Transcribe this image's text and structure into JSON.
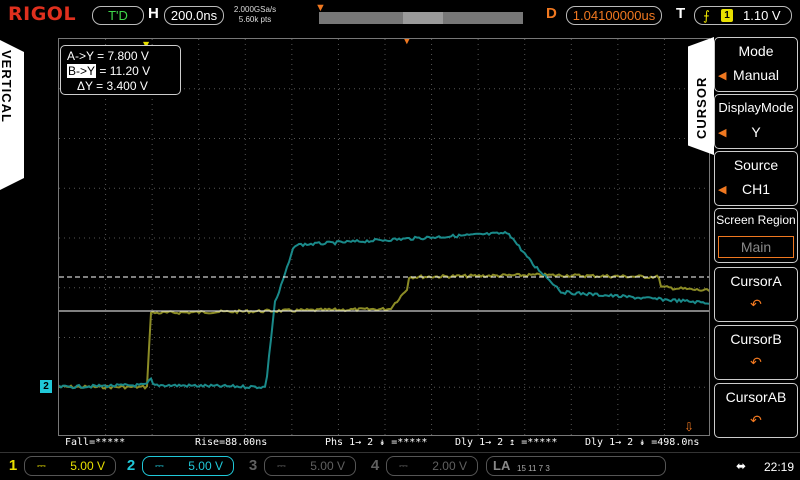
{
  "brand": {
    "logo": "RIGOL"
  },
  "topbar": {
    "trigger_status": "T'D",
    "h_label": "H",
    "timebase": "200.0ns",
    "sample_rate": "2.000GSa/s",
    "mem_depth": "5.60k pts",
    "d_label": "D",
    "delay": "1.04100000us",
    "t_label": "T",
    "trig_source": "1",
    "trig_level": "1.10 V"
  },
  "left_tab": {
    "label": "VERTICAL"
  },
  "cursor_readout": {
    "a_line": "A->Y = 7.800 V",
    "b_prefix": "B->Y",
    "b_value": " = 11.20 V",
    "delta_line": "ΔY = 3.400 V"
  },
  "measurements": {
    "fall": "Fall=*****",
    "rise": "Rise=88.00ns",
    "phs": "Phs 1→ 2 ↡ =*****",
    "dly_a": "Dly 1→ 2 ↥ =*****",
    "dly_b": "Dly 1→ 2 ↡ =498.0ns"
  },
  "right_tab": {
    "label": "CURSOR"
  },
  "menu": {
    "mode_title": "Mode",
    "mode_value": "Manual",
    "display_title": "DisplayMode",
    "display_value": "Y",
    "source_title": "Source",
    "source_value": "CH1",
    "region_title": "Screen Region",
    "region_value": "Main",
    "cursor_a": "CursorA",
    "cursor_b": "CursorB",
    "cursor_ab": "CursorAB",
    "knob_icon": "↶"
  },
  "channels": [
    {
      "num": "1",
      "coupling": "⎓",
      "scale": "5.00 V",
      "color": "#e8e000"
    },
    {
      "num": "2",
      "coupling": "⎓",
      "scale": "5.00 V",
      "color": "#20c8d8"
    },
    {
      "num": "3",
      "coupling": "⎓",
      "scale": "5.00 V",
      "color": "#606060"
    },
    {
      "num": "4",
      "coupling": "⎓",
      "scale": "2.00 V",
      "color": "#606060"
    }
  ],
  "la": {
    "label": "LA",
    "nums": "15  11  7  3"
  },
  "status": {
    "time": "22:19",
    "usb_icon": "⬌"
  },
  "ch2_marker": "2",
  "colors": {
    "ch1": "#8c8c26",
    "ch2": "#1a8a8a",
    "accent": "#f07820"
  }
}
